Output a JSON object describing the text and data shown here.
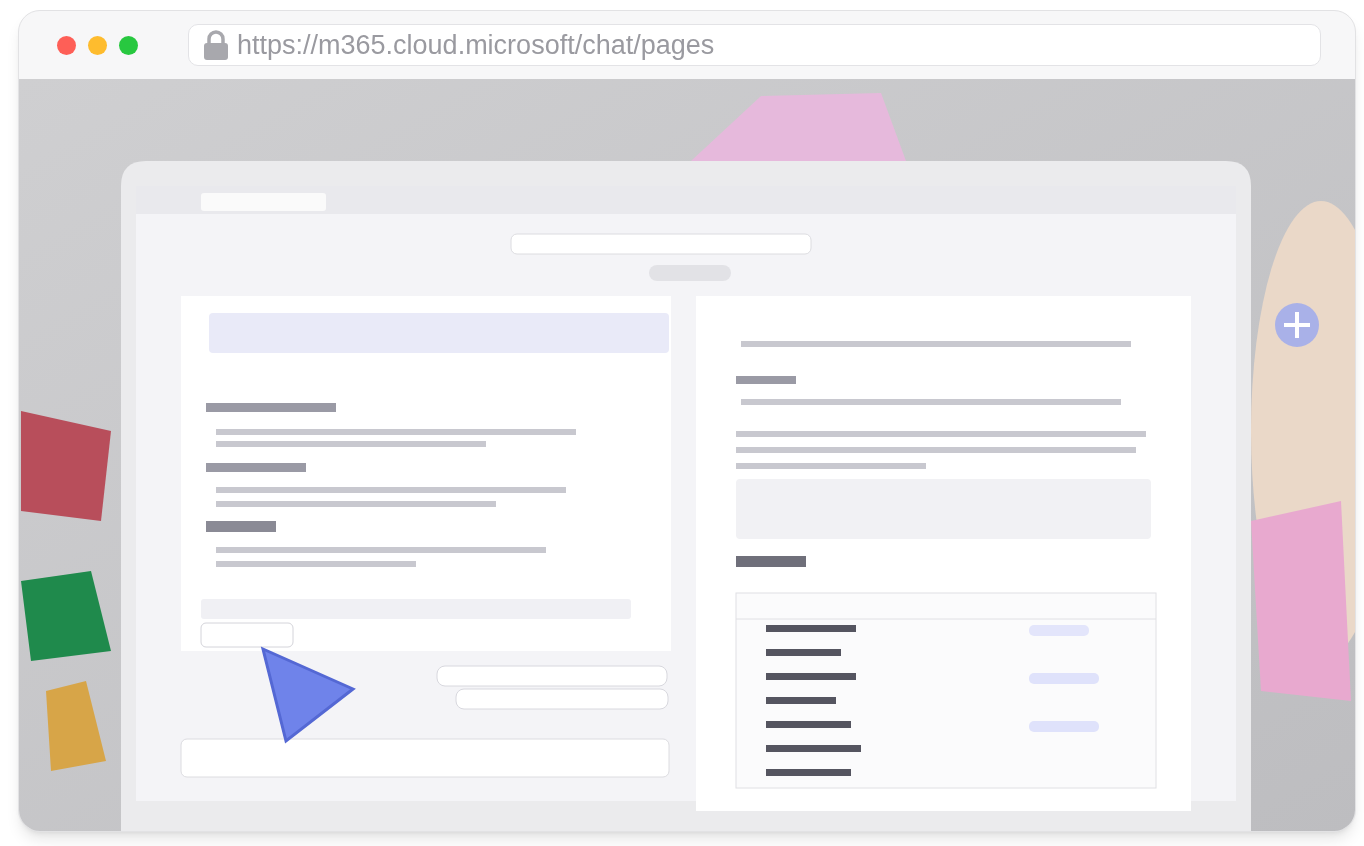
{
  "browser": {
    "url": "https://m365.cloud.microsoft/chat/pages"
  }
}
